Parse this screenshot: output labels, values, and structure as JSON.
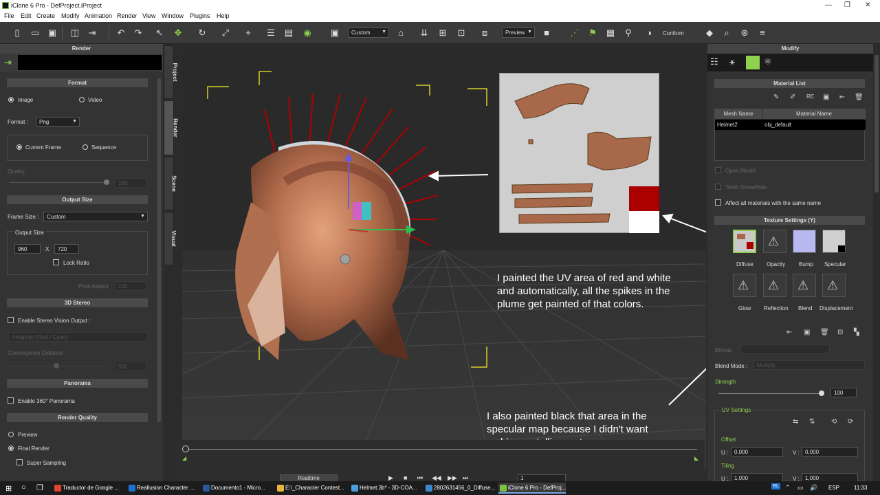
{
  "window": {
    "title": "iClone 6 Pro - DefProject.iProject",
    "min": "—",
    "max": "❐",
    "close": "✕"
  },
  "menu": [
    "File",
    "Edit",
    "Create",
    "Modify",
    "Animation",
    "Render",
    "View",
    "Window",
    "Plugins",
    "Help"
  ],
  "toolbar": {
    "camera_combo": "Custom",
    "preview_combo": "Preview",
    "conform": "Conform"
  },
  "render_panel": {
    "title": "Render",
    "format": {
      "header": "Format",
      "image": "Image",
      "video": "Video",
      "format_label": "Format :",
      "format_value": "Png",
      "current_frame": "Current Frame",
      "sequence": "Sequence",
      "quality": "Quality",
      "quality_value": "100"
    },
    "output_size": {
      "header": "Output Size",
      "frame_size_label": "Frame Size :",
      "frame_size_value": "Custom",
      "output_size_label": "Output Size",
      "width": "960",
      "x": "X",
      "height": "720",
      "lock_ratio": "Lock Ratio",
      "pixel_aspect": "Pixel Aspect",
      "pixel_aspect_value": "100"
    },
    "stereo": {
      "header": "3D Stereo",
      "enable": "Enable Stereo Vision Output :",
      "mode": "Anaglyph (Red / Cyan)",
      "convergence": "Convergence Distance",
      "convergence_value": "500"
    },
    "panorama": {
      "header": "Panorama",
      "enable": "Enable 360° Panorama"
    },
    "quality": {
      "header": "Render Quality",
      "preview": "Preview",
      "final": "Final Render",
      "super": "Super Sampling"
    }
  },
  "side_tabs": [
    "Project",
    "Render",
    "Scene",
    "Visual"
  ],
  "modify_panel": {
    "title": "Modify",
    "material_list": {
      "header": "Material List",
      "col_mesh": "Mesh Name",
      "col_material": "Material Name",
      "rows": [
        {
          "mesh": "Helmet2",
          "material": "obj_default"
        }
      ],
      "open_mouth": "Open Mouth",
      "teeth": "Teeth Show/Hide",
      "affect_all": "Affect all materials with the same name"
    },
    "texture_settings": {
      "header": "Texture Settings  (Y)",
      "channels": [
        "Diffuse",
        "Opacity",
        "Bump",
        "Specular",
        "Glow",
        "Reflection",
        "Blend",
        "Displacement"
      ]
    },
    "bitmap": "Bitmap",
    "blend_mode_label": "Blend Mode :",
    "blend_mode_value": "Multiply",
    "strength_label": "Strength",
    "strength_value": "100",
    "strength_level": 1.0,
    "uv": {
      "header": "UV Settings",
      "offset": "Offset",
      "u": "U :",
      "v": "V :",
      "offset_u": "0,000",
      "offset_v": "0,000",
      "tiling": "Tiling",
      "tiling_u": "1,000",
      "tiling_v": "1,000"
    }
  },
  "annotations": {
    "a1": [
      "I painted the UV area of red and white",
      "and automatically, all the spikes in the",
      "plume get painted of that colors."
    ],
    "a2": [
      "I also painted black that area in the",
      "specular map because I didn't want",
      "a shiny metallic crest"
    ]
  },
  "timeline": {
    "mode": "Realtime",
    "frame": "1"
  },
  "taskbar": {
    "items": [
      {
        "label": "Traductor de Google ...",
        "color": "#e0452f"
      },
      {
        "label": "Reallusion Character ...",
        "color": "#1f6fd0"
      },
      {
        "label": "Documento1 - Micro...",
        "color": "#2b579a"
      },
      {
        "label": "E:\\_Character Contest...",
        "color": "#e8b63a"
      },
      {
        "label": "Helmet.3b* - 3D-COA...",
        "color": "#4aa0d8"
      },
      {
        "label": "2802631456_0_Diffuse...",
        "color": "#3a8ad0"
      },
      {
        "label": "iClone 6 Pro - DefProj...",
        "color": "#7ac142"
      }
    ],
    "lang": "ESP",
    "time": "11:33",
    "tray_rl": "RL"
  },
  "colors": {
    "accent": "#8fd14f",
    "panel": "#333333",
    "header": "#4a4a4a"
  }
}
